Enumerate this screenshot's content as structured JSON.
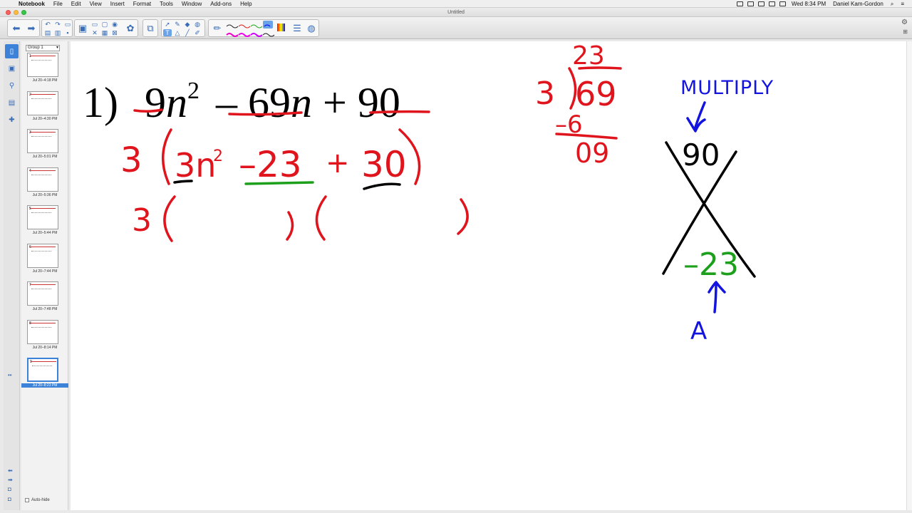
{
  "menubar": {
    "app": "Notebook",
    "items": [
      "File",
      "Edit",
      "View",
      "Insert",
      "Format",
      "Tools",
      "Window",
      "Add-ons",
      "Help"
    ],
    "clock": "Wed 8:34 PM",
    "user": "Daniel Kam-Gordon"
  },
  "window": {
    "title": "Untitled"
  },
  "sorter": {
    "group": "Group 1",
    "pages": [
      {
        "num": "1",
        "time": "Jul 20–4:18 PM"
      },
      {
        "num": "2",
        "time": "Jul 20–4:30 PM"
      },
      {
        "num": "3",
        "time": "Jul 20–5:01 PM"
      },
      {
        "num": "4",
        "time": "Jul 20–5:36 PM"
      },
      {
        "num": "5",
        "time": "Jul 20–5:44 PM"
      },
      {
        "num": "6",
        "time": "Jul 20–7:44 PM"
      },
      {
        "num": "7",
        "time": "Jul 20–7:48 PM"
      },
      {
        "num": "8",
        "time": "Jul 20–8:14 PM"
      },
      {
        "num": "9",
        "time": "Jul 20–8:23 PM"
      }
    ],
    "autohide": "Auto-hide"
  },
  "problem": {
    "number": "1)",
    "c1": "9",
    "v1": "n",
    "exp": "2",
    "op1": "–",
    "c2": "69",
    "v2": "n",
    "op2": "+",
    "c3": "90"
  },
  "handwriting": {
    "factor_line": {
      "gcf": "3",
      "open": "(",
      "t1": "3n",
      "t1_exp": "2",
      "t2": "–23",
      "plus": "+",
      "t3": "30",
      "close": ")"
    },
    "binomial_line": {
      "gcf": "3",
      "p1": "(",
      "p2": ")(",
      "p3": ")"
    },
    "division": {
      "quotient": "23",
      "divisor": "3",
      "dividend": "69",
      "sub": "–6",
      "rem": "09"
    },
    "x_box": {
      "label": "MULTIPLY",
      "top": "90",
      "bottom": "–23",
      "note": "A"
    }
  },
  "colors": {
    "ink_red": "#e0141c",
    "ink_green": "#1ca01c",
    "ink_blue": "#1414e0",
    "ink_black": "#000000",
    "selection_blue": "#3b82d8"
  }
}
